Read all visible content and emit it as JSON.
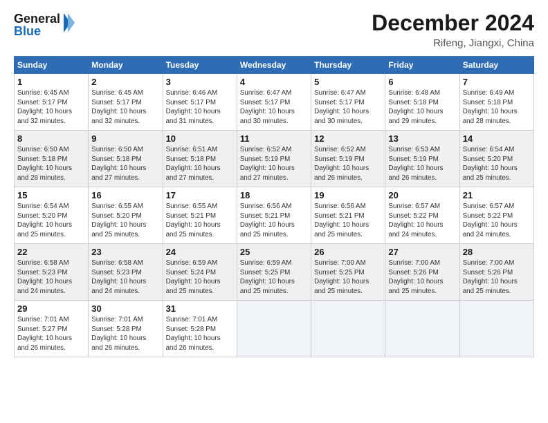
{
  "header": {
    "logo_general": "General",
    "logo_blue": "Blue",
    "month_title": "December 2024",
    "subtitle": "Rifeng, Jiangxi, China"
  },
  "calendar": {
    "days_of_week": [
      "Sunday",
      "Monday",
      "Tuesday",
      "Wednesday",
      "Thursday",
      "Friday",
      "Saturday"
    ],
    "weeks": [
      [
        {
          "day": "",
          "info": ""
        },
        {
          "day": "2",
          "info": "Sunrise: 6:45 AM\nSunset: 5:17 PM\nDaylight: 10 hours\nand 32 minutes."
        },
        {
          "day": "3",
          "info": "Sunrise: 6:46 AM\nSunset: 5:17 PM\nDaylight: 10 hours\nand 31 minutes."
        },
        {
          "day": "4",
          "info": "Sunrise: 6:47 AM\nSunset: 5:17 PM\nDaylight: 10 hours\nand 30 minutes."
        },
        {
          "day": "5",
          "info": "Sunrise: 6:47 AM\nSunset: 5:17 PM\nDaylight: 10 hours\nand 30 minutes."
        },
        {
          "day": "6",
          "info": "Sunrise: 6:48 AM\nSunset: 5:18 PM\nDaylight: 10 hours\nand 29 minutes."
        },
        {
          "day": "7",
          "info": "Sunrise: 6:49 AM\nSunset: 5:18 PM\nDaylight: 10 hours\nand 28 minutes."
        }
      ],
      [
        {
          "day": "1",
          "info": "Sunrise: 6:45 AM\nSunset: 5:17 PM\nDaylight: 10 hours\nand 32 minutes."
        },
        {
          "day": "9",
          "info": "Sunrise: 6:50 AM\nSunset: 5:18 PM\nDaylight: 10 hours\nand 27 minutes."
        },
        {
          "day": "10",
          "info": "Sunrise: 6:51 AM\nSunset: 5:18 PM\nDaylight: 10 hours\nand 27 minutes."
        },
        {
          "day": "11",
          "info": "Sunrise: 6:52 AM\nSunset: 5:19 PM\nDaylight: 10 hours\nand 27 minutes."
        },
        {
          "day": "12",
          "info": "Sunrise: 6:52 AM\nSunset: 5:19 PM\nDaylight: 10 hours\nand 26 minutes."
        },
        {
          "day": "13",
          "info": "Sunrise: 6:53 AM\nSunset: 5:19 PM\nDaylight: 10 hours\nand 26 minutes."
        },
        {
          "day": "14",
          "info": "Sunrise: 6:54 AM\nSunset: 5:20 PM\nDaylight: 10 hours\nand 25 minutes."
        }
      ],
      [
        {
          "day": "8",
          "info": "Sunrise: 6:50 AM\nSunset: 5:18 PM\nDaylight: 10 hours\nand 28 minutes."
        },
        {
          "day": "16",
          "info": "Sunrise: 6:55 AM\nSunset: 5:20 PM\nDaylight: 10 hours\nand 25 minutes."
        },
        {
          "day": "17",
          "info": "Sunrise: 6:55 AM\nSunset: 5:21 PM\nDaylight: 10 hours\nand 25 minutes."
        },
        {
          "day": "18",
          "info": "Sunrise: 6:56 AM\nSunset: 5:21 PM\nDaylight: 10 hours\nand 25 minutes."
        },
        {
          "day": "19",
          "info": "Sunrise: 6:56 AM\nSunset: 5:21 PM\nDaylight: 10 hours\nand 25 minutes."
        },
        {
          "day": "20",
          "info": "Sunrise: 6:57 AM\nSunset: 5:22 PM\nDaylight: 10 hours\nand 24 minutes."
        },
        {
          "day": "21",
          "info": "Sunrise: 6:57 AM\nSunset: 5:22 PM\nDaylight: 10 hours\nand 24 minutes."
        }
      ],
      [
        {
          "day": "15",
          "info": "Sunrise: 6:54 AM\nSunset: 5:20 PM\nDaylight: 10 hours\nand 25 minutes."
        },
        {
          "day": "23",
          "info": "Sunrise: 6:58 AM\nSunset: 5:23 PM\nDaylight: 10 hours\nand 24 minutes."
        },
        {
          "day": "24",
          "info": "Sunrise: 6:59 AM\nSunset: 5:24 PM\nDaylight: 10 hours\nand 25 minutes."
        },
        {
          "day": "25",
          "info": "Sunrise: 6:59 AM\nSunset: 5:25 PM\nDaylight: 10 hours\nand 25 minutes."
        },
        {
          "day": "26",
          "info": "Sunrise: 7:00 AM\nSunset: 5:25 PM\nDaylight: 10 hours\nand 25 minutes."
        },
        {
          "day": "27",
          "info": "Sunrise: 7:00 AM\nSunset: 5:26 PM\nDaylight: 10 hours\nand 25 minutes."
        },
        {
          "day": "28",
          "info": "Sunrise: 7:00 AM\nSunset: 5:26 PM\nDaylight: 10 hours\nand 25 minutes."
        }
      ],
      [
        {
          "day": "22",
          "info": "Sunrise: 6:58 AM\nSunset: 5:23 PM\nDaylight: 10 hours\nand 24 minutes."
        },
        {
          "day": "30",
          "info": "Sunrise: 7:01 AM\nSunset: 5:28 PM\nDaylight: 10 hours\nand 26 minutes."
        },
        {
          "day": "31",
          "info": "Sunrise: 7:01 AM\nSunset: 5:28 PM\nDaylight: 10 hours\nand 26 minutes."
        },
        {
          "day": "",
          "info": ""
        },
        {
          "day": "",
          "info": ""
        },
        {
          "day": "",
          "info": ""
        },
        {
          "day": "",
          "info": ""
        }
      ],
      [
        {
          "day": "29",
          "info": "Sunrise: 7:01 AM\nSunset: 5:27 PM\nDaylight: 10 hours\nand 26 minutes."
        },
        {
          "day": "",
          "info": ""
        },
        {
          "day": "",
          "info": ""
        },
        {
          "day": "",
          "info": ""
        },
        {
          "day": "",
          "info": ""
        },
        {
          "day": "",
          "info": ""
        },
        {
          "day": "",
          "info": ""
        }
      ]
    ]
  }
}
